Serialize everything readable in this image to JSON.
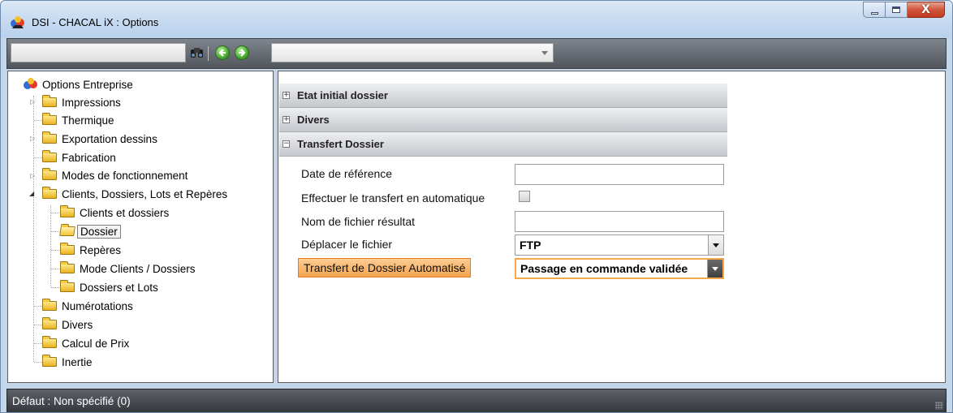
{
  "window": {
    "title": "DSI - CHACAL iX : Options",
    "controls": {
      "minimize": "–",
      "maximize": "□",
      "close": "X"
    }
  },
  "toolbar": {
    "search_value": "",
    "nav_combo_value": "",
    "icons": [
      "binoculars-icon",
      "back-arrow-icon",
      "forward-arrow-icon"
    ]
  },
  "tree": {
    "root": "Options Entreprise",
    "items": [
      {
        "label": "Impressions"
      },
      {
        "label": "Thermique"
      },
      {
        "label": "Exportation dessins"
      },
      {
        "label": "Fabrication"
      },
      {
        "label": "Modes de fonctionnement"
      },
      {
        "label": "Clients, Dossiers, Lots et Repères"
      },
      {
        "label": "Clients et dossiers"
      },
      {
        "label": "Dossier"
      },
      {
        "label": "Repères"
      },
      {
        "label": "Mode Clients / Dossiers"
      },
      {
        "label": "Dossiers et Lots"
      },
      {
        "label": "Numérotations"
      },
      {
        "label": "Divers"
      },
      {
        "label": "Calcul de Prix"
      },
      {
        "label": "Inertie"
      }
    ],
    "selected": "Dossier"
  },
  "options": {
    "sections": [
      {
        "label": "Etat initial dossier",
        "toggle": "+"
      },
      {
        "label": "Divers",
        "toggle": "+"
      },
      {
        "label": "Transfert Dossier",
        "toggle": "−"
      }
    ],
    "properties": {
      "date_reference": {
        "label": "Date de référence",
        "value": ""
      },
      "auto_transfer": {
        "label": "Effectuer le transfert en automatique",
        "checked": false
      },
      "result_file": {
        "label": "Nom de fichier résultat",
        "value": ""
      },
      "move_file": {
        "label": "Déplacer le fichier",
        "value": "FTP"
      },
      "auto_transfer_mode": {
        "label": "Transfert de Dossier Automatisé",
        "value": "Passage en commande validée"
      }
    }
  },
  "status": {
    "text": "Défaut : Non spécifié (0)"
  },
  "colors": {
    "highlight": "#f5a34f",
    "toolbar": "#51565d",
    "statusbar": "#35383d",
    "title_gradient": "#c7dbf1"
  }
}
